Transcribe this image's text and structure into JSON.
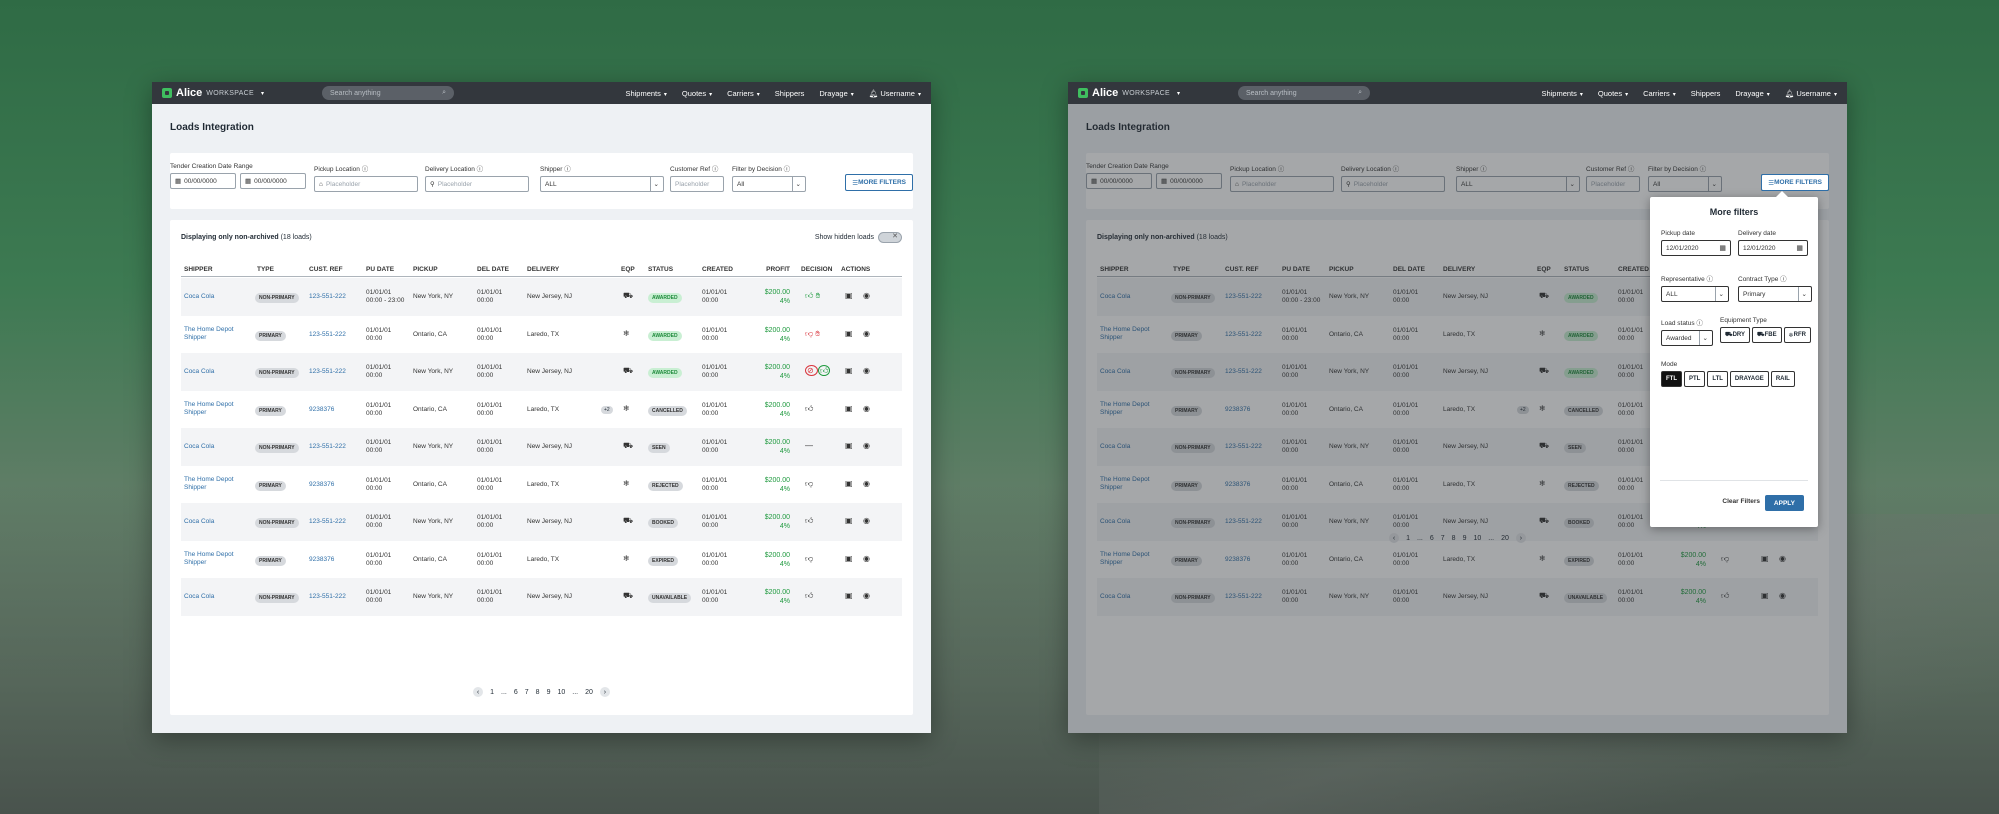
{
  "app": {
    "name": "Alice",
    "workspace": "WORKSPACE",
    "search_placeholder": "Search anything",
    "nav": [
      "Shipments",
      "Quotes",
      "Carriers",
      "Shippers",
      "Drayage"
    ],
    "username": "Username"
  },
  "page": {
    "title": "Loads Integration"
  },
  "filters": {
    "tender_label": "Tender Creation Date Range",
    "date_from": "00/00/0000",
    "date_to": "00/00/0000",
    "pickup_label": "Pickup Location",
    "pickup_placeholder": "Placeholder",
    "delivery_label": "Delivery Location",
    "delivery_placeholder": "Placeholder",
    "shipper_label": "Shipper",
    "shipper_value": "ALL",
    "custref_label": "Customer Ref",
    "custref_placeholder": "Placeholder",
    "decision_label": "Filter by Decision",
    "decision_value": "All",
    "more_filters": "MORE FILTERS"
  },
  "table": {
    "displaying": "Displaying only non-archived",
    "count": "(18 loads)",
    "show_hidden": "Show hidden loads",
    "columns": [
      "SHIPPER",
      "TYPE",
      "CUST. REF",
      "PU DATE",
      "PICKUP",
      "DEL DATE",
      "DELIVERY",
      "EQP",
      "STATUS",
      "CREATED",
      "PROFIT",
      "DECISION",
      "ACTIONS"
    ],
    "rows": [
      {
        "shipper": "Coca Cola",
        "type": "NON-PRIMARY",
        "ref": "123-551-222",
        "pu1": "01/01/01",
        "pu2": "00:00 - 23:00",
        "pickup": "New York, NY",
        "del1": "01/01/01",
        "del2": "00:00",
        "delivery": "New Jersey, NJ",
        "eqp": "truck",
        "status": "AWARDED",
        "status_green": true,
        "cr1": "01/01/01",
        "cr2": "00:00",
        "profit": "$200.00",
        "pct": "4%",
        "decision": "up-green"
      },
      {
        "shipper": "The Home Depot Shipper",
        "type": "PRIMARY",
        "ref": "123-551-222",
        "pu1": "01/01/01",
        "pu2": "00:00",
        "pickup": "Ontario, CA",
        "del1": "01/01/01",
        "del2": "00:00",
        "delivery": "Laredo, TX",
        "eqp": "snow",
        "status": "AWARDED",
        "status_green": true,
        "cr1": "01/01/01",
        "cr2": "00:00",
        "profit": "$200.00",
        "pct": "4%",
        "decision": "down-red"
      },
      {
        "shipper": "Coca Cola",
        "type": "NON-PRIMARY",
        "ref": "123-551-222",
        "pu1": "01/01/01",
        "pu2": "00:00",
        "pickup": "New York, NY",
        "del1": "01/01/01",
        "del2": "00:00",
        "delivery": "New Jersey, NJ",
        "eqp": "truck",
        "status": "AWARDED",
        "status_green": true,
        "cr1": "01/01/01",
        "cr2": "00:00",
        "profit": "$200.00",
        "pct": "4%",
        "decision": "rings"
      },
      {
        "shipper": "The Home Depot Shipper",
        "type": "PRIMARY",
        "ref": "9238376",
        "pu1": "01/01/01",
        "pu2": "00:00",
        "pickup": "Ontario, CA",
        "del1": "01/01/01",
        "del2": "00:00",
        "delivery": "Laredo, TX",
        "eqp": "snow",
        "extra": "+2",
        "status": "CANCELLED",
        "status_green": false,
        "cr1": "01/01/01",
        "cr2": "00:00",
        "profit": "$200.00",
        "pct": "4%",
        "decision": "up"
      },
      {
        "shipper": "Coca Cola",
        "type": "NON-PRIMARY",
        "ref": "123-551-222",
        "pu1": "01/01/01",
        "pu2": "00:00",
        "pickup": "New York, NY",
        "del1": "01/01/01",
        "del2": "00:00",
        "delivery": "New Jersey, NJ",
        "eqp": "truck",
        "status": "SEEN",
        "status_green": false,
        "cr1": "01/01/01",
        "cr2": "00:00",
        "profit": "$200.00",
        "pct": "4%",
        "decision": "dash"
      },
      {
        "shipper": "The Home Depot Shipper",
        "type": "PRIMARY",
        "ref": "9238376",
        "pu1": "01/01/01",
        "pu2": "00:00",
        "pickup": "Ontario, CA",
        "del1": "01/01/01",
        "del2": "00:00",
        "delivery": "Laredo, TX",
        "eqp": "snow",
        "status": "REJECTED",
        "status_green": false,
        "cr1": "01/01/01",
        "cr2": "00:00",
        "profit": "$200.00",
        "pct": "4%",
        "decision": "down"
      },
      {
        "shipper": "Coca Cola",
        "type": "NON-PRIMARY",
        "ref": "123-551-222",
        "pu1": "01/01/01",
        "pu2": "00:00",
        "pickup": "New York, NY",
        "del1": "01/01/01",
        "del2": "00:00",
        "delivery": "New Jersey, NJ",
        "eqp": "truck",
        "status": "BOOKED",
        "status_green": false,
        "cr1": "01/01/01",
        "cr2": "00:00",
        "profit": "$200.00",
        "pct": "4%",
        "decision": "up"
      },
      {
        "shipper": "The Home Depot Shipper",
        "type": "PRIMARY",
        "ref": "9238376",
        "pu1": "01/01/01",
        "pu2": "00:00",
        "pickup": "Ontario, CA",
        "del1": "01/01/01",
        "del2": "00:00",
        "delivery": "Laredo, TX",
        "eqp": "snow",
        "status": "EXPIRED",
        "status_green": false,
        "cr1": "01/01/01",
        "cr2": "00:00",
        "profit": "$200.00",
        "pct": "4%",
        "decision": "down"
      },
      {
        "shipper": "Coca Cola",
        "type": "NON-PRIMARY",
        "ref": "123-551-222",
        "pu1": "01/01/01",
        "pu2": "00:00",
        "pickup": "New York, NY",
        "del1": "01/01/01",
        "del2": "00:00",
        "delivery": "New Jersey, NJ",
        "eqp": "truck",
        "status": "UNAVAILABLE",
        "status_green": false,
        "cr1": "01/01/01",
        "cr2": "00:00",
        "profit": "$200.00",
        "pct": "4%",
        "decision": "up"
      }
    ]
  },
  "pagination": {
    "pages": [
      "1",
      "...",
      "6",
      "7",
      "8",
      "9",
      "10",
      "...",
      "20"
    ]
  },
  "more_filters_panel": {
    "title": "More filters",
    "pickup_date_label": "Pickup date",
    "pickup_date": "12/01/2020",
    "delivery_date_label": "Delivery date",
    "delivery_date": "12/01/2020",
    "rep_label": "Representative",
    "rep_value": "ALL",
    "contract_label": "Contract Type",
    "contract_value": "Primary",
    "load_status_label": "Load status",
    "load_status_value": "Awarded",
    "equipment_label": "Equipment Type",
    "equipment": [
      "DRY",
      "FBE",
      "RFR"
    ],
    "mode_label": "Mode",
    "modes": [
      "FTL",
      "PTL",
      "LTL",
      "DRAYAGE",
      "RAIL"
    ],
    "clear": "Clear Filters",
    "apply": "APPLY"
  },
  "colors": {
    "brand_green": "#3fbf5f",
    "link_blue": "#2f6fa8",
    "profit_green": "#1f9a3f",
    "topbar": "#33373d"
  }
}
